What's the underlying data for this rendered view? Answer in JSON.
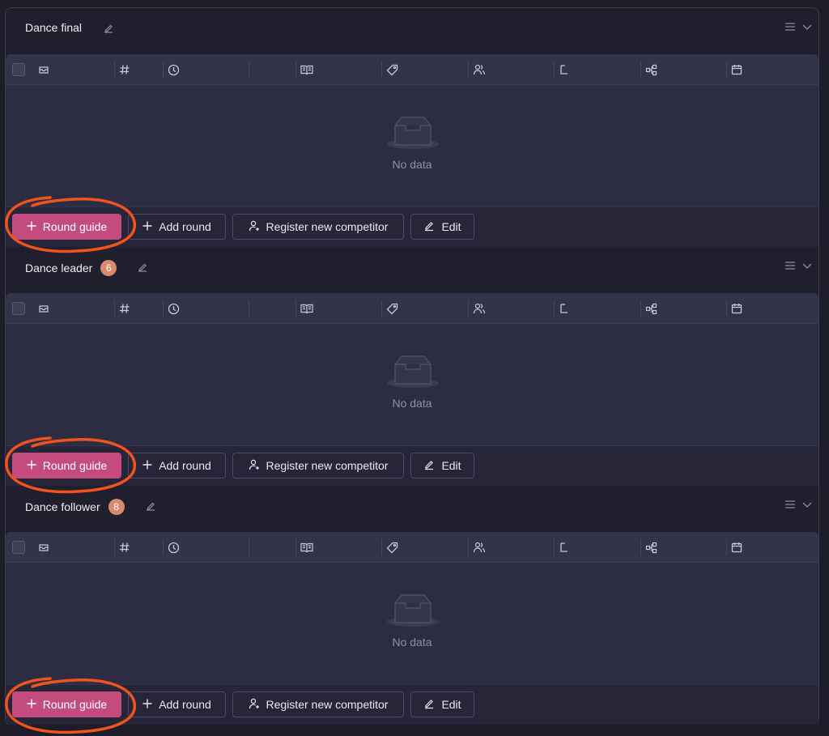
{
  "colors": {
    "background": "#1d1d2a",
    "panel": "#2c2c42",
    "primary_button": "#c44b7d",
    "badge": "#d98a6c",
    "annotation": "#f0531d"
  },
  "sections": [
    {
      "title": "Dance final",
      "badge": "",
      "empty_text": "No data",
      "buttons": {
        "round_guide": "Round guide",
        "add_round": "Add round",
        "register": "Register new competitor",
        "edit": "Edit"
      }
    },
    {
      "title": "Dance leader",
      "badge": "6",
      "empty_text": "No data",
      "buttons": {
        "round_guide": "Round guide",
        "add_round": "Add round",
        "register": "Register new competitor",
        "edit": "Edit"
      }
    },
    {
      "title": "Dance follower",
      "badge": "8",
      "empty_text": "No data",
      "buttons": {
        "round_guide": "Round guide",
        "add_round": "Add round",
        "register": "Register new competitor",
        "edit": "Edit"
      }
    }
  ],
  "columns": [
    {
      "icon": "inbox-icon"
    },
    {
      "icon": "hash-icon"
    },
    {
      "icon": "clock-icon"
    },
    {
      "icon": "blank"
    },
    {
      "icon": "book-icon"
    },
    {
      "icon": "tag-icon"
    },
    {
      "icon": "users-icon"
    },
    {
      "icon": "return-icon"
    },
    {
      "icon": "cluster-icon"
    },
    {
      "icon": "calendar-icon"
    }
  ]
}
